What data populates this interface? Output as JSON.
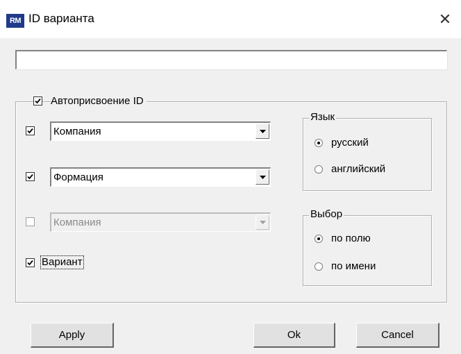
{
  "window": {
    "icon_text": "RM",
    "title": "ID варианта",
    "close_glyph": "✕"
  },
  "id_field": {
    "value": ""
  },
  "auto_assign": {
    "label": "Автоприсвоение ID",
    "checked": true,
    "rows": [
      {
        "checked": true,
        "enabled": true,
        "value": "Компания"
      },
      {
        "checked": true,
        "enabled": true,
        "value": "Формация"
      },
      {
        "checked": false,
        "enabled": false,
        "value": "Компания"
      }
    ],
    "variant_label": "Вариант",
    "variant_checked": true
  },
  "language_group": {
    "title": "Язык",
    "options": [
      {
        "label": "русский",
        "selected": true
      },
      {
        "label": "английский",
        "selected": false
      }
    ]
  },
  "selection_group": {
    "title": "Выбор",
    "options": [
      {
        "label": "по полю",
        "selected": true
      },
      {
        "label": "по имени",
        "selected": false
      }
    ]
  },
  "buttons": {
    "apply": "Apply",
    "ok": "Ok",
    "cancel": "Cancel"
  },
  "icons": {
    "checkmark": "checkmark-icon",
    "dropdown": "dropdown-arrow-icon",
    "close": "close-icon"
  }
}
